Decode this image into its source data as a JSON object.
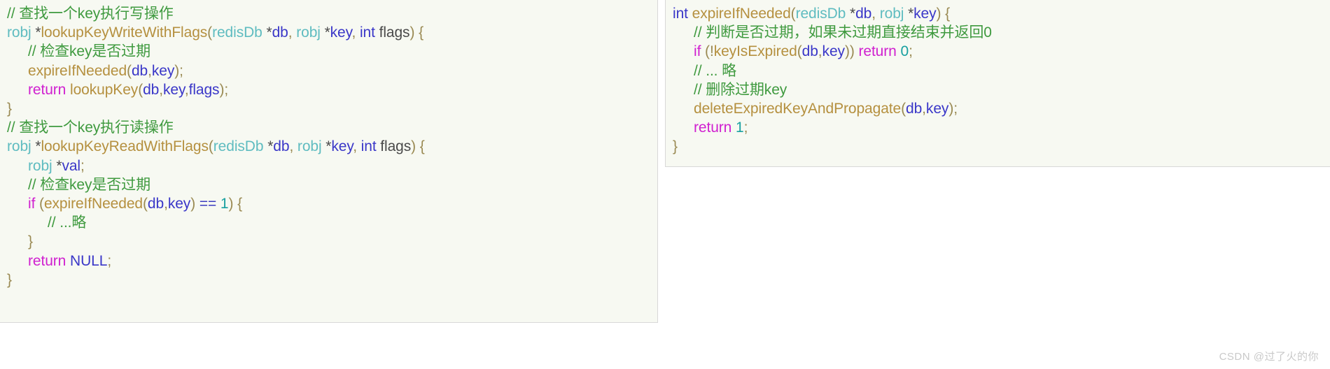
{
  "left_block": {
    "name": "lookup-key-code-block",
    "background_color": "#f7f9f2",
    "border_color": "#d8d8d8",
    "lines": [
      {
        "indent": 0,
        "tokens": [
          {
            "t": "// 查找一个key执行写操作",
            "c": "comment"
          }
        ]
      },
      {
        "indent": 0,
        "tokens": [
          {
            "t": "robj",
            "c": "type"
          },
          {
            "t": " *",
            "c": "star"
          },
          {
            "t": "lookupKeyWriteWithFlags",
            "c": "func"
          },
          {
            "t": "(",
            "c": "punct"
          },
          {
            "t": "redisDb",
            "c": "type"
          },
          {
            "t": " *",
            "c": "star"
          },
          {
            "t": "db",
            "c": "var"
          },
          {
            "t": ", ",
            "c": "punct"
          },
          {
            "t": "robj",
            "c": "type"
          },
          {
            "t": " *",
            "c": "star"
          },
          {
            "t": "key",
            "c": "var"
          },
          {
            "t": ", ",
            "c": "punct"
          },
          {
            "t": "int",
            "c": "keyword-int"
          },
          {
            "t": " flags",
            "c": "plain"
          },
          {
            "t": ") {",
            "c": "punct"
          }
        ]
      },
      {
        "indent": 1,
        "tokens": [
          {
            "t": "// 检查key是否过期",
            "c": "comment"
          }
        ]
      },
      {
        "indent": 1,
        "tokens": [
          {
            "t": "expireIfNeeded",
            "c": "func"
          },
          {
            "t": "(",
            "c": "punct"
          },
          {
            "t": "db",
            "c": "var"
          },
          {
            "t": ",",
            "c": "punct"
          },
          {
            "t": "key",
            "c": "var"
          },
          {
            "t": ");",
            "c": "punct"
          }
        ]
      },
      {
        "indent": 1,
        "tokens": [
          {
            "t": "return",
            "c": "keyword"
          },
          {
            "t": " ",
            "c": "plain"
          },
          {
            "t": "lookupKey",
            "c": "func"
          },
          {
            "t": "(",
            "c": "punct"
          },
          {
            "t": "db",
            "c": "var"
          },
          {
            "t": ",",
            "c": "punct"
          },
          {
            "t": "key",
            "c": "var"
          },
          {
            "t": ",",
            "c": "punct"
          },
          {
            "t": "flags",
            "c": "var"
          },
          {
            "t": ");",
            "c": "punct"
          }
        ]
      },
      {
        "indent": 0,
        "tokens": [
          {
            "t": "}",
            "c": "brace"
          }
        ]
      },
      {
        "indent": 0,
        "tokens": [
          {
            "t": "// 查找一个key执行读操作",
            "c": "comment"
          }
        ]
      },
      {
        "indent": 0,
        "tokens": [
          {
            "t": "robj",
            "c": "type"
          },
          {
            "t": " *",
            "c": "star"
          },
          {
            "t": "lookupKeyReadWithFlags",
            "c": "func"
          },
          {
            "t": "(",
            "c": "punct"
          },
          {
            "t": "redisDb",
            "c": "type"
          },
          {
            "t": " *",
            "c": "star"
          },
          {
            "t": "db",
            "c": "var"
          },
          {
            "t": ", ",
            "c": "punct"
          },
          {
            "t": "robj",
            "c": "type"
          },
          {
            "t": " *",
            "c": "star"
          },
          {
            "t": "key",
            "c": "var"
          },
          {
            "t": ", ",
            "c": "punct"
          },
          {
            "t": "int",
            "c": "keyword-int"
          },
          {
            "t": " flags",
            "c": "plain"
          },
          {
            "t": ") {",
            "c": "punct"
          }
        ]
      },
      {
        "indent": 1,
        "tokens": [
          {
            "t": "robj",
            "c": "type"
          },
          {
            "t": " *",
            "c": "star"
          },
          {
            "t": "val",
            "c": "var"
          },
          {
            "t": ";",
            "c": "punct"
          }
        ]
      },
      {
        "indent": 1,
        "tokens": [
          {
            "t": "// 检查key是否过期",
            "c": "comment"
          }
        ]
      },
      {
        "indent": 1,
        "tokens": [
          {
            "t": "if",
            "c": "keyword"
          },
          {
            "t": " (",
            "c": "punct"
          },
          {
            "t": "expireIfNeeded",
            "c": "func"
          },
          {
            "t": "(",
            "c": "punct"
          },
          {
            "t": "db",
            "c": "var"
          },
          {
            "t": ",",
            "c": "punct"
          },
          {
            "t": "key",
            "c": "var"
          },
          {
            "t": ") ",
            "c": "punct"
          },
          {
            "t": "==",
            "c": "op"
          },
          {
            "t": " ",
            "c": "plain"
          },
          {
            "t": "1",
            "c": "num"
          },
          {
            "t": ") {",
            "c": "punct"
          }
        ]
      },
      {
        "indent": 2,
        "tokens": [
          {
            "t": "// ...略",
            "c": "comment"
          }
        ]
      },
      {
        "indent": 1,
        "tokens": [
          {
            "t": "}",
            "c": "brace"
          }
        ]
      },
      {
        "indent": 1,
        "tokens": [
          {
            "t": "return",
            "c": "keyword"
          },
          {
            "t": " ",
            "c": "plain"
          },
          {
            "t": "NULL",
            "c": "var"
          },
          {
            "t": ";",
            "c": "punct"
          }
        ]
      },
      {
        "indent": 0,
        "tokens": [
          {
            "t": "}",
            "c": "brace"
          }
        ]
      }
    ]
  },
  "right_block": {
    "name": "expire-if-needed-code-block",
    "background_color": "#f7f9f2",
    "border_color": "#d8d8d8",
    "lines": [
      {
        "indent": 0,
        "tokens": [
          {
            "t": "int",
            "c": "keyword-int"
          },
          {
            "t": " ",
            "c": "plain"
          },
          {
            "t": "expireIfNeeded",
            "c": "func"
          },
          {
            "t": "(",
            "c": "punct"
          },
          {
            "t": "redisDb",
            "c": "type"
          },
          {
            "t": " *",
            "c": "star"
          },
          {
            "t": "db",
            "c": "var"
          },
          {
            "t": ", ",
            "c": "punct"
          },
          {
            "t": "robj",
            "c": "type"
          },
          {
            "t": " *",
            "c": "star"
          },
          {
            "t": "key",
            "c": "var"
          },
          {
            "t": ") {",
            "c": "punct"
          }
        ]
      },
      {
        "indent": 1,
        "tokens": [
          {
            "t": "// 判断是否过期，如果未过期直接结束并返回0",
            "c": "comment"
          }
        ]
      },
      {
        "indent": 1,
        "tokens": [
          {
            "t": "if",
            "c": "keyword"
          },
          {
            "t": " (!",
            "c": "punct"
          },
          {
            "t": "keyIsExpired",
            "c": "func"
          },
          {
            "t": "(",
            "c": "punct"
          },
          {
            "t": "db",
            "c": "var"
          },
          {
            "t": ",",
            "c": "punct"
          },
          {
            "t": "key",
            "c": "var"
          },
          {
            "t": ")) ",
            "c": "punct"
          },
          {
            "t": "return",
            "c": "keyword"
          },
          {
            "t": " ",
            "c": "plain"
          },
          {
            "t": "0",
            "c": "num"
          },
          {
            "t": ";",
            "c": "punct"
          }
        ]
      },
      {
        "indent": 1,
        "tokens": [
          {
            "t": "// ... 略",
            "c": "comment"
          }
        ]
      },
      {
        "indent": 1,
        "tokens": [
          {
            "t": "// 删除过期key",
            "c": "comment"
          }
        ]
      },
      {
        "indent": 1,
        "tokens": [
          {
            "t": "deleteExpiredKeyAndPropagate",
            "c": "func"
          },
          {
            "t": "(",
            "c": "punct"
          },
          {
            "t": "db",
            "c": "var"
          },
          {
            "t": ",",
            "c": "punct"
          },
          {
            "t": "key",
            "c": "var"
          },
          {
            "t": ");",
            "c": "punct"
          }
        ]
      },
      {
        "indent": 1,
        "tokens": [
          {
            "t": "return",
            "c": "keyword"
          },
          {
            "t": " ",
            "c": "plain"
          },
          {
            "t": "1",
            "c": "num"
          },
          {
            "t": ";",
            "c": "punct"
          }
        ]
      },
      {
        "indent": 0,
        "tokens": [
          {
            "t": "}",
            "c": "brace"
          }
        ]
      }
    ]
  },
  "watermark": {
    "text": "CSDN @过了火的你",
    "color": "#c9c9c9"
  },
  "colors": {
    "comment": "#3f9a3f",
    "keyword": "#d021d0",
    "type": "#5fbcc0",
    "function": "#b5903f",
    "variable": "#3a37c8",
    "number": "#18a0a0",
    "punctuation": "#9a8a53",
    "page_background": "#ffffff",
    "block_background": "#f7f9f2"
  }
}
